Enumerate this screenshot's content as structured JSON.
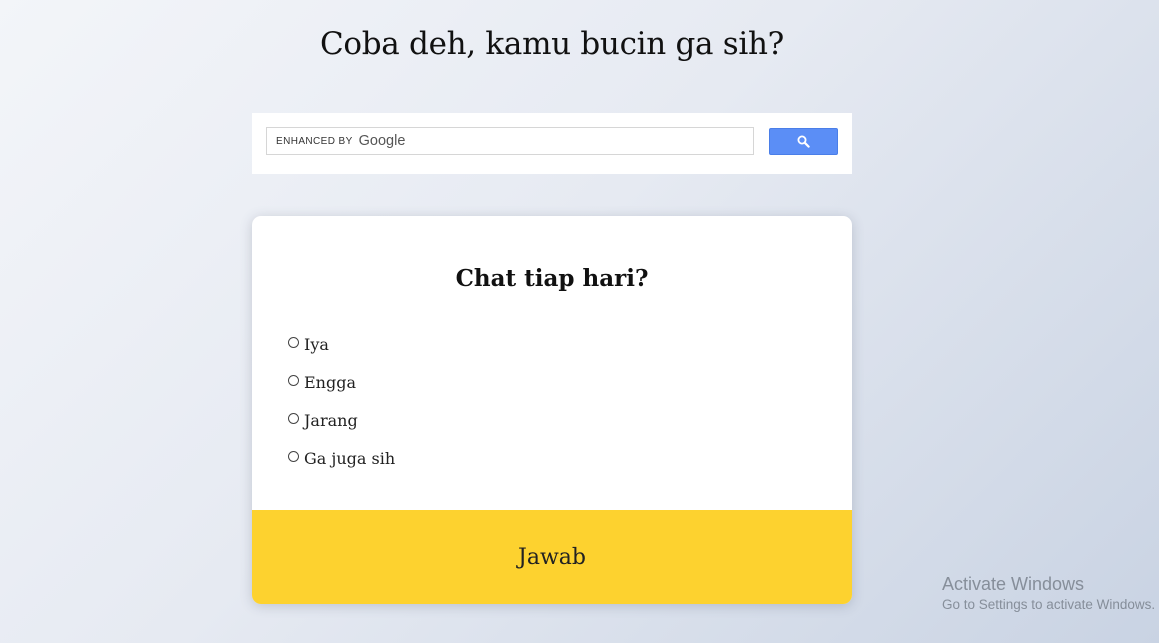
{
  "page": {
    "title": "Coba deh, kamu bucin ga sih?"
  },
  "search": {
    "enhanced_label": "ENHANCED BY",
    "brand": "Google",
    "button_icon": "search-icon",
    "button_color": "#5b8ef6"
  },
  "quiz": {
    "question": "Chat tiap hari?",
    "options": [
      {
        "label": "Iya"
      },
      {
        "label": "Engga"
      },
      {
        "label": "Jarang"
      },
      {
        "label": "Ga juga sih"
      }
    ],
    "submit_label": "Jawab",
    "submit_color": "#fdd22f"
  },
  "watermark": {
    "title": "Activate Windows",
    "subtitle": "Go to Settings to activate Windows."
  }
}
